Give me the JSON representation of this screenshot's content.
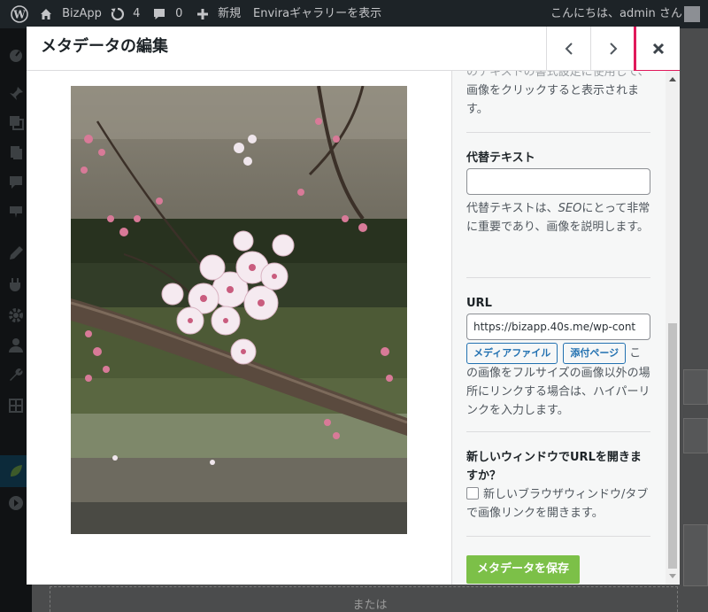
{
  "admin_bar": {
    "site_name": "BizApp",
    "updates_count": "4",
    "comments_count": "0",
    "new_label": "新規",
    "view_gallery": "Enviraギャラリーを表示",
    "greeting": "こんにちは、admin さん"
  },
  "background": {
    "or_text": "または"
  },
  "modal": {
    "title": "メタデータの編集",
    "caption_help_top": "のテキストの書式設定に使用して、",
    "caption_help_mid": "画像をクリックすると表示されま",
    "caption_help_end": "す。",
    "alt": {
      "label": "代替テキスト",
      "value": "",
      "help_pre": "代替テキストは、",
      "help_em": "SEO",
      "help_post": "にとって非常に重要であり、画像を説明します。"
    },
    "url": {
      "label": "URL",
      "value": "https://bizapp.40s.me/wp-cont",
      "media_file_button": "メディアファイル",
      "attachment_page_button": "添付ページ",
      "help": "この画像をフルサイズの画像以外の場所にリンクする場合は、ハイパーリンクを入力します。"
    },
    "new_window": {
      "label": "新しいウィンドウでURLを開きますか？",
      "checkbox_label": "新しいブラウザウィンドウ/タブで画像リンクを開きます。",
      "checked": false
    },
    "save_button": "メタデータを保存"
  },
  "icons": {
    "prev": "chevron-left-icon",
    "next": "chevron-right-icon",
    "close": "close-icon"
  },
  "colors": {
    "save_green": "#7cc048",
    "highlight": "#e0195b",
    "link_blue": "#2271b1"
  }
}
